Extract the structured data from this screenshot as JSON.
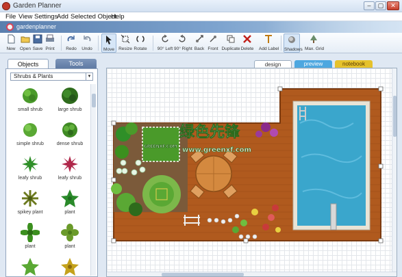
{
  "window": {
    "title": "Garden Planner",
    "controls": {
      "minimize": "–",
      "maximize": "▢",
      "close": "✕"
    }
  },
  "menu": [
    "File",
    "View",
    "Settings",
    "Add",
    "Selected Object",
    "Help"
  ],
  "banner": {
    "logo": "gardenplanner"
  },
  "toolbar": [
    {
      "id": "new",
      "label": "New",
      "icon": "new-file-icon"
    },
    {
      "id": "open",
      "label": "Open",
      "icon": "open-folder-icon"
    },
    {
      "id": "save",
      "label": "Save",
      "icon": "save-disk-icon"
    },
    {
      "id": "print",
      "label": "Print",
      "icon": "printer-icon"
    },
    {
      "id": "redo",
      "label": "Redo",
      "icon": "redo-arrow-icon"
    },
    {
      "id": "undo",
      "label": "Undo",
      "icon": "undo-arrow-icon"
    },
    {
      "id": "move",
      "label": "Move",
      "icon": "cursor-arrow-icon",
      "selected": true
    },
    {
      "id": "resize",
      "label": "Resize",
      "icon": "resize-icon"
    },
    {
      "id": "rotate",
      "label": "Rotate",
      "icon": "rotate-icon"
    },
    {
      "id": "rot-left",
      "label": "90° Left",
      "icon": "rotate-left-icon"
    },
    {
      "id": "rot-right",
      "label": "90° Right",
      "icon": "rotate-right-icon"
    },
    {
      "id": "back",
      "label": "Back",
      "icon": "send-back-icon"
    },
    {
      "id": "front",
      "label": "Front",
      "icon": "bring-front-icon"
    },
    {
      "id": "duplicate",
      "label": "Duplicate",
      "icon": "duplicate-icon"
    },
    {
      "id": "delete",
      "label": "Delete",
      "icon": "delete-x-icon"
    },
    {
      "id": "add-label",
      "label": "Add Label",
      "icon": "text-label-icon"
    },
    {
      "id": "shadows",
      "label": "Shadows",
      "icon": "shadows-icon"
    },
    {
      "id": "max-grid",
      "label": "Max. Grid",
      "icon": "grid-tree-icon"
    }
  ],
  "left_panel": {
    "tabs": {
      "objects": "Objects",
      "tools": "Tools"
    },
    "category": "Shrubs & Plants",
    "plants": [
      {
        "label": "small shrub",
        "color": "#4a9a2a"
      },
      {
        "label": "large shrub",
        "color": "#2e6b1c"
      },
      {
        "label": "simple shrub",
        "color": "#5aa834"
      },
      {
        "label": "dense shrub",
        "color": "#3f8a24"
      },
      {
        "label": "leafy shrub",
        "color": "#2f8f28"
      },
      {
        "label": "leafy shrub",
        "color": "#b0274a"
      },
      {
        "label": "spikey plant",
        "color": "#6c7a1e"
      },
      {
        "label": "plant",
        "color": "#2a8a2a"
      },
      {
        "label": "plant",
        "color": "#3b8f1e"
      },
      {
        "label": "plant",
        "color": "#6a9a2a"
      },
      {
        "label": "",
        "color": "#5aa834"
      },
      {
        "label": "",
        "color": "#c4a21c"
      }
    ]
  },
  "view_tabs": [
    {
      "label": "design",
      "bg": "#ffffff",
      "fg": "#333333"
    },
    {
      "label": "preview",
      "bg": "#4da7e0",
      "fg": "#ffffff"
    },
    {
      "label": "notebook",
      "bg": "#e6c22c",
      "fg": "#5a3b00"
    }
  ],
  "watermark": {
    "cn": "绿色先锋",
    "url": "www.greenxf.com",
    "small": "GREENXF.COM"
  },
  "colors": {
    "deck": "#b05a1e",
    "pool": "#3aa6cc",
    "patio": "#7b5a3a"
  }
}
